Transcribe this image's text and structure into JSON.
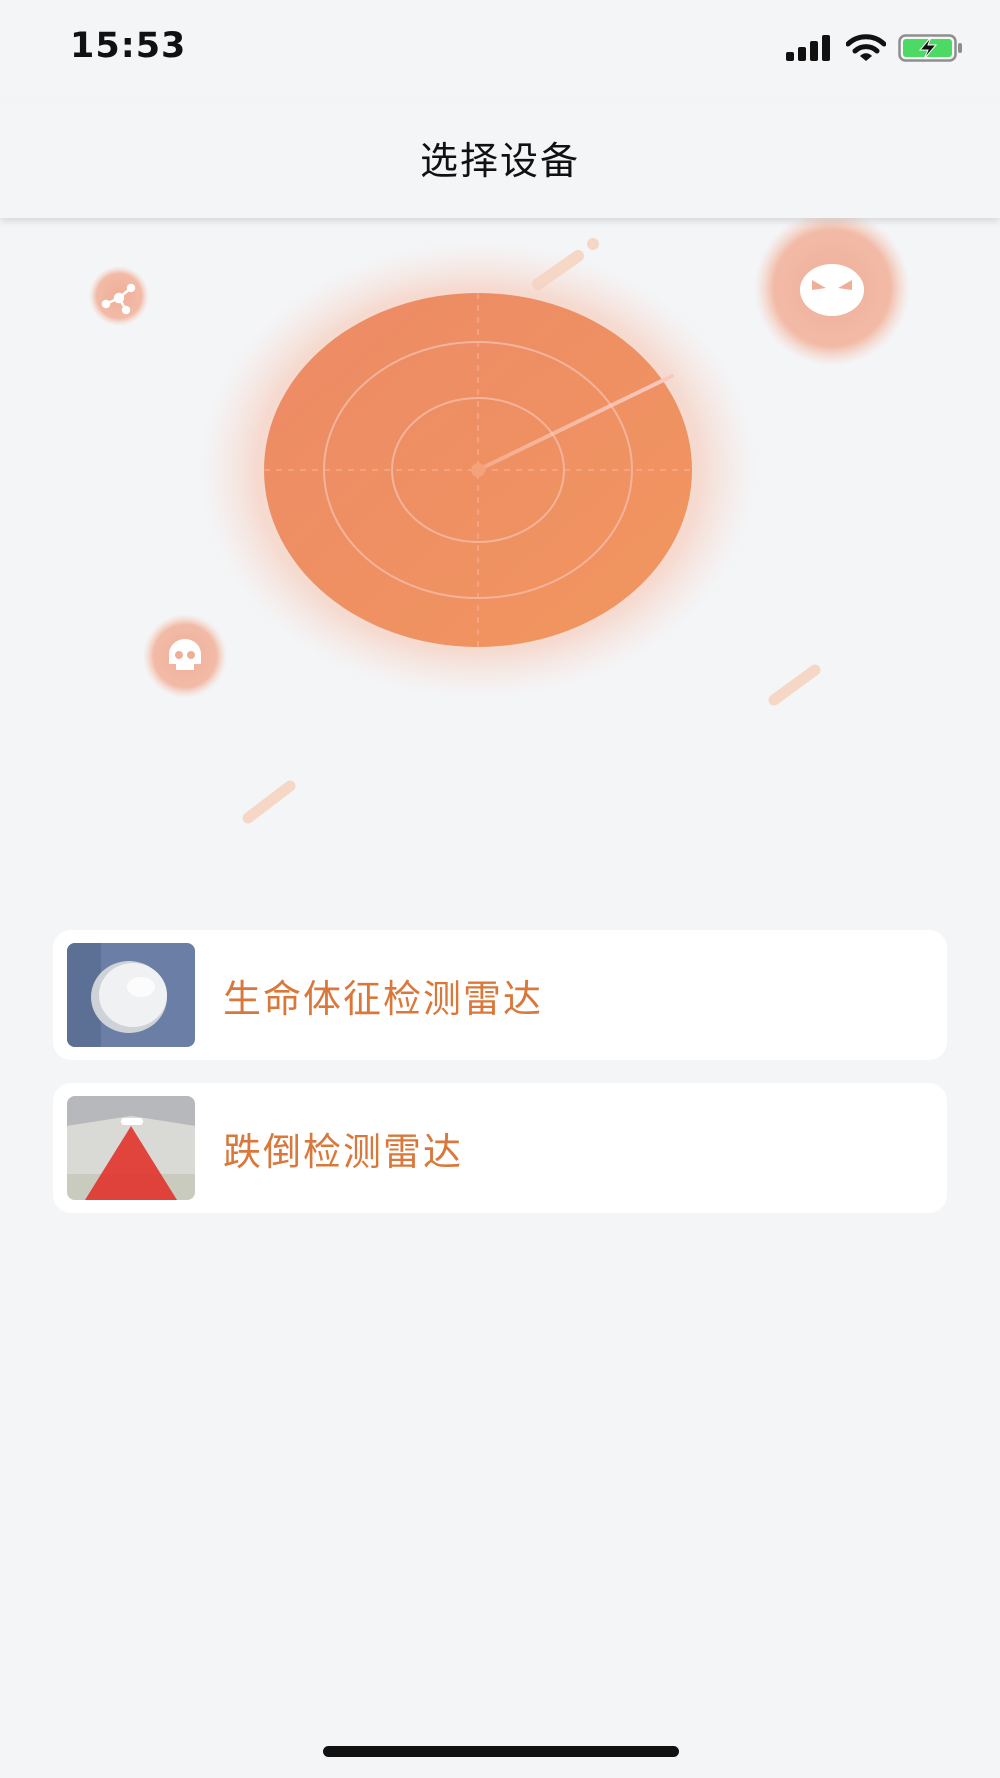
{
  "status_bar": {
    "time": "15:53",
    "icons": [
      "cellular-signal-icon",
      "wifi-icon",
      "battery-charging-icon"
    ],
    "battery_color": "#4cd964"
  },
  "nav": {
    "title": "选择设备"
  },
  "illustration": {
    "accent_color": "#ef8a5c",
    "icons": [
      "share-icon",
      "angry-face-icon",
      "skull-icon"
    ]
  },
  "devices": [
    {
      "name": "生命体征检测雷达",
      "thumb_icon": "wall-mounted-sensor-icon"
    },
    {
      "name": "跌倒检测雷达",
      "thumb_icon": "ceiling-radar-icon"
    }
  ],
  "colors": {
    "background": "#f4f5f7",
    "card": "#ffffff",
    "device_text": "#d9783a"
  }
}
